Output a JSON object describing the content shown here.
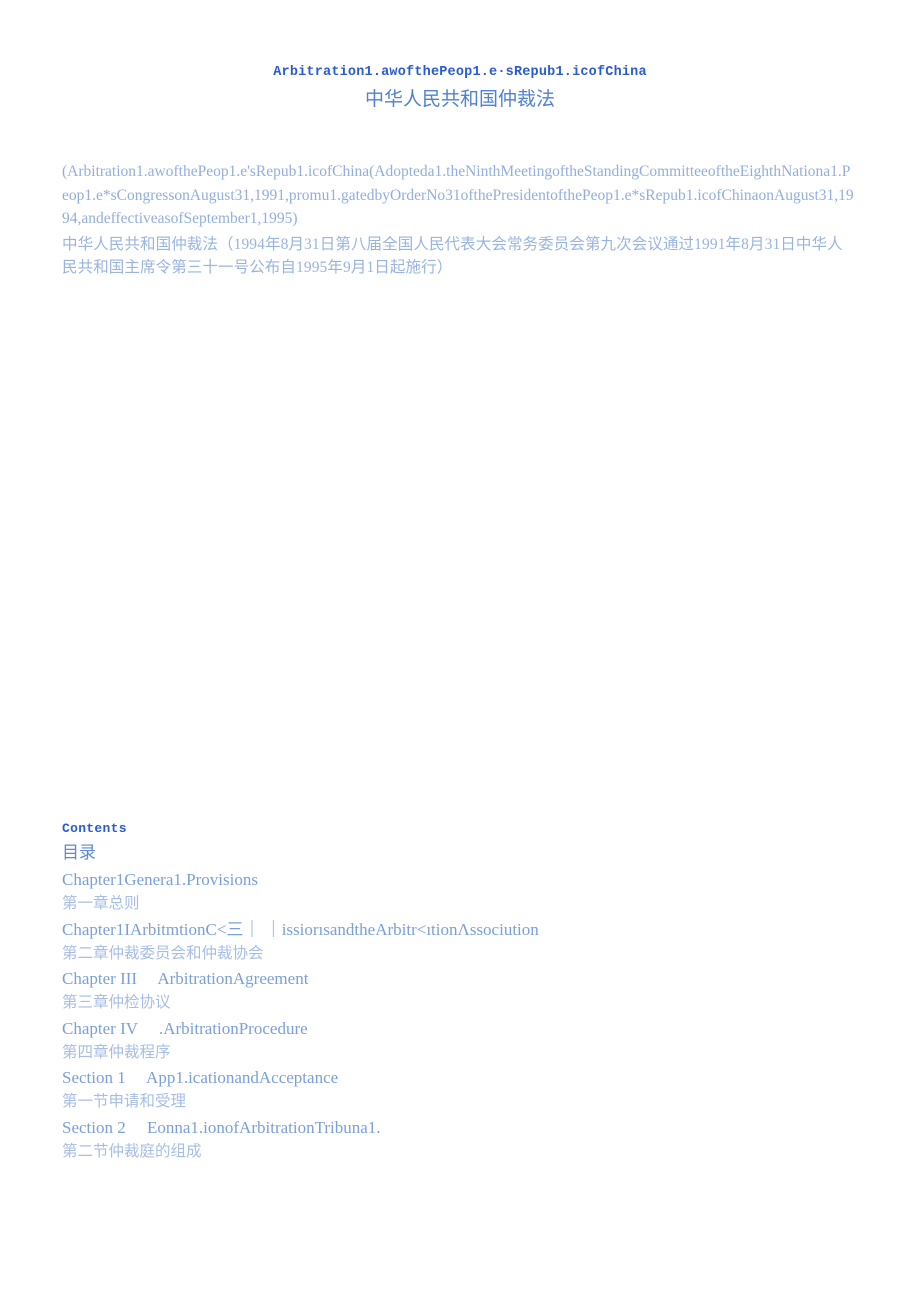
{
  "document": {
    "title_en": "Arbitration1.awofthePeop1.e·sRepub1.icofChina",
    "title_cn": "中华人民共和国仲裁法"
  },
  "intro": {
    "paragraph_en": "(Arbitration1.awofthePeop1.e'sRepub1.icofChina(Adopteda1.theNinthMeetingoftheStandingCommitteeoftheEighthNationa1.Peop1.e*sCongressonAugust31,1991,promu1.gatedbyOrderNo31ofthePresidentofthePeop1.e*sRepub1.icofChinaonAugust31,1994,andeffectiveasofSeptember1,1995)",
    "paragraph_cn": "中华人民共和国仲裁法（1994年8月31日第八届全国人民代表大会常务委员会第九次会议通过1991年8月31日中华人民共和国主席令第三十一号公布自1995年9月1日起施行）"
  },
  "contents": {
    "heading_en": "Contents",
    "heading_cn": "目录",
    "entries": [
      {
        "en": "Chapter1Genera1.Provisions",
        "cn": "第一章总则"
      },
      {
        "en": "Chapter1IArbitmtionC<三｜ ｜issiorısandtheArbitr<ıtionΛssociution",
        "cn": "第二章仲裁委员会和仲裁协会"
      },
      {
        "en": "Chapter III     ArbitrationAgreement",
        "cn": "第三章仲检协议"
      },
      {
        "en": "Chapter IV     .ArbitrationProcedure",
        "cn": "第四章仲裁程序"
      },
      {
        "en": "Section 1     App1.icationandAcceptance",
        "cn": "第一节申请和受理"
      },
      {
        "en": "Section 2     Eonna1.ionofArbitrationTribuna1.",
        "cn": "第二节仲裁庭的组成"
      }
    ]
  },
  "colors": {
    "title_accent": "#2a5bd0",
    "title_cn": "#4f81d6",
    "body_text": "#93aede",
    "toc_en": "#7b9fdb",
    "toc_cn": "#a7bee4",
    "background": "#ffffff"
  }
}
